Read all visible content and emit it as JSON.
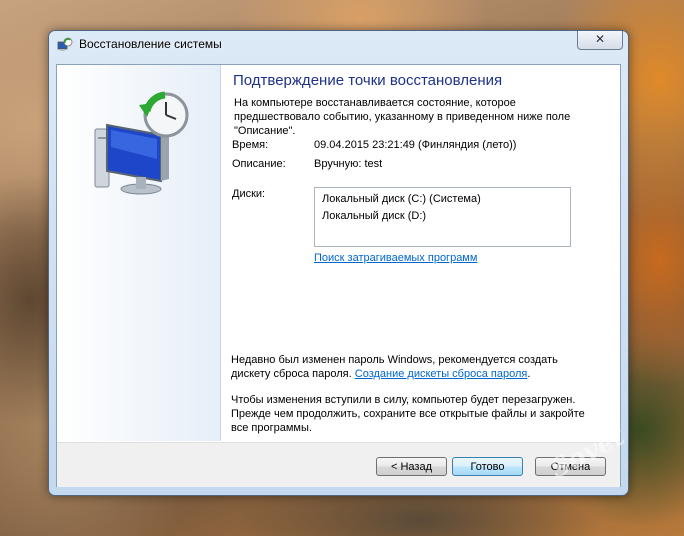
{
  "window": {
    "title": "Восстановление системы",
    "close_glyph": "✕"
  },
  "dialog": {
    "heading": "Подтверждение точки восстановления",
    "intro": "На компьютере восстанавливается состояние, которое предшествовало событию, указанному в приведенном ниже поле \"Описание\".",
    "time_label": "Время:",
    "time_value": "09.04.2015 23:21:49 (Финляндия (лето))",
    "description_label": "Описание:",
    "description_value": "Вручную: test",
    "disks_label": "Диски:",
    "disks": [
      "Локальный диск (C:) (Система)",
      "Локальный диск (D:)"
    ],
    "affected_link": "Поиск затрагиваемых программ",
    "password_note_text": "Недавно был изменен пароль Windows, рекомендуется создать дискету сброса пароля.",
    "password_note_link": "Создание дискеты сброса пароля",
    "password_note_end": ".",
    "restart_note": "Чтобы изменения вступили в силу, компьютер будет перезагружен. Прежде чем продолжить, сохраните все открытые файлы и закройте все программы."
  },
  "buttons": {
    "back": "< Назад",
    "finish": "Готово",
    "cancel": "Отмена"
  },
  "watermark": "Sovet",
  "icons": {
    "app": "system-restore-icon",
    "hero": "restore-computer-clock-icon"
  },
  "colors": {
    "heading": "#1e3287",
    "link": "#0066cc",
    "default_button": "#3c7fb1"
  }
}
